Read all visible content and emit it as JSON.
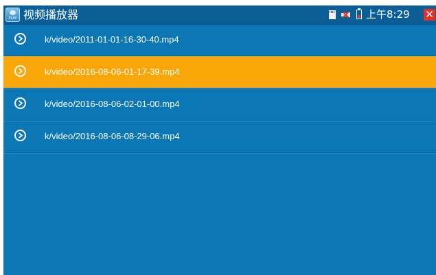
{
  "titlebar": {
    "app_icon_label": "PLAY",
    "title": "视频播放器",
    "status": {
      "icons": [
        "sd-card-icon",
        "usb-icon",
        "battery-icon"
      ],
      "time": "上午8:29",
      "close_symbol": "✕"
    }
  },
  "files": [
    {
      "name": "k/video/2011-01-01-16-30-40.mp4",
      "selected": false
    },
    {
      "name": "k/video/2016-08-06-01-17-39.mp4",
      "selected": true
    },
    {
      "name": "k/video/2016-08-06-02-01-00.mp4",
      "selected": false
    },
    {
      "name": "k/video/2016-08-06-08-29-06.mp4",
      "selected": false
    }
  ],
  "colors": {
    "background": "#0b77b5",
    "titlebar": "#0b5f96",
    "selected_row": "#f9a608",
    "close": "#e23326"
  }
}
